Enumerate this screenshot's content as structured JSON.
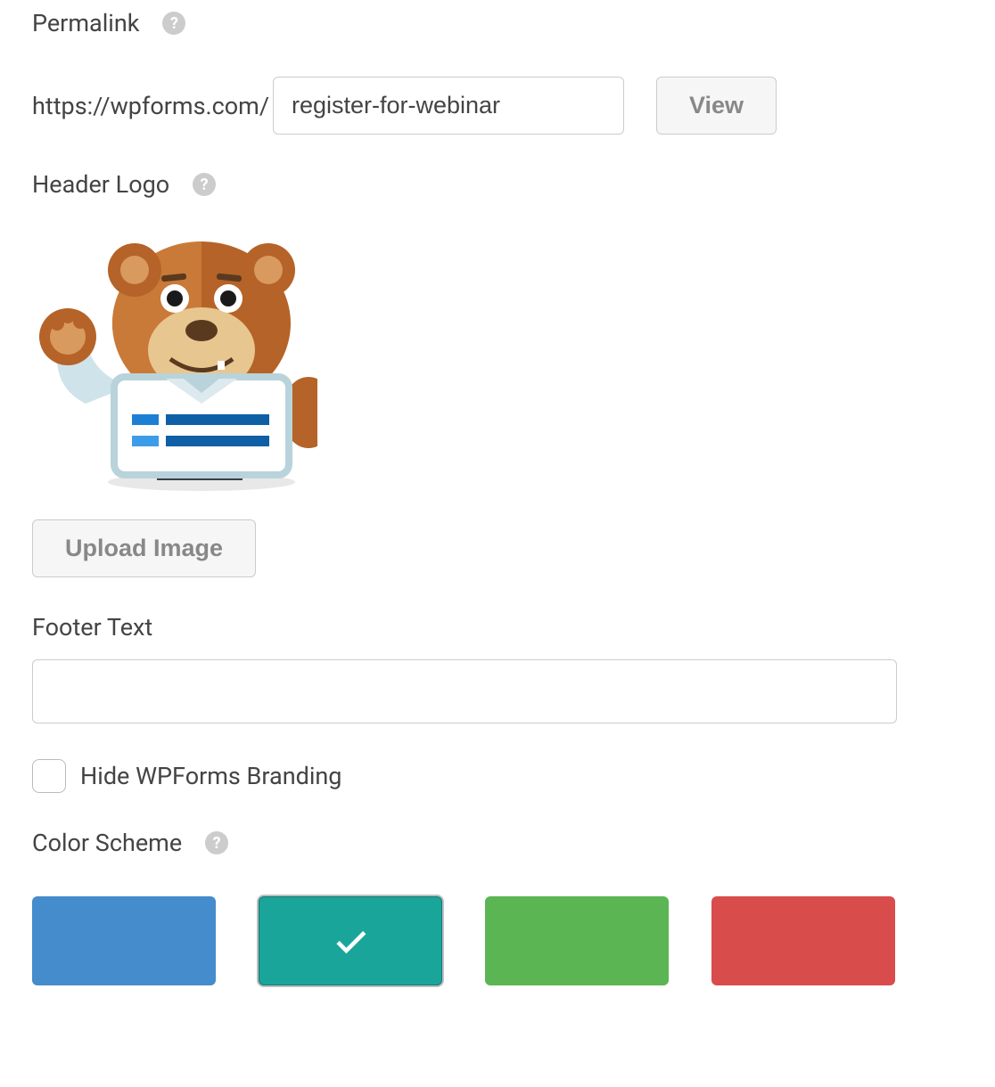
{
  "permalink": {
    "label": "Permalink",
    "prefix": "https://wpforms.com/",
    "value": "register-for-webinar",
    "view_label": "View"
  },
  "header_logo": {
    "label": "Header Logo",
    "upload_label": "Upload Image"
  },
  "footer": {
    "label": "Footer Text",
    "value": ""
  },
  "branding": {
    "label": "Hide WPForms Branding",
    "checked": false
  },
  "color_scheme": {
    "label": "Color Scheme",
    "options": [
      {
        "color": "#448ccb",
        "selected": false
      },
      {
        "color": "#1aa59b",
        "selected": true
      },
      {
        "color": "#5ab552",
        "selected": false
      },
      {
        "color": "#d94c4c",
        "selected": false
      }
    ]
  }
}
